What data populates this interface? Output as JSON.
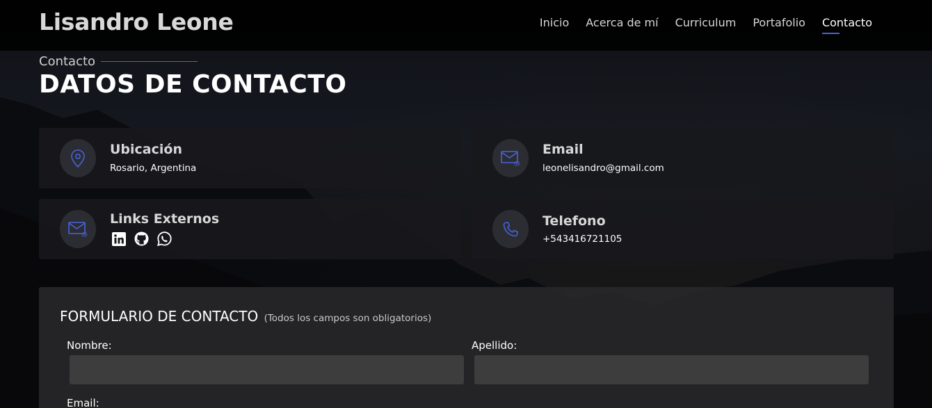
{
  "header": {
    "logo": "Lisandro Leone",
    "nav": [
      "Inicio",
      "Acerca de mí",
      "Curriculum",
      "Portafolio",
      "Contacto"
    ],
    "active": "Contacto"
  },
  "section": {
    "subtitle": "Contacto",
    "title": "DATOS DE CONTACTO"
  },
  "cards": {
    "location": {
      "title": "Ubicación",
      "text": "Rosario, Argentina",
      "icon": "map-pin-icon"
    },
    "email": {
      "title": "Email",
      "text": "leonelisandro@gmail.com",
      "icon": "envelope-icon"
    },
    "links": {
      "title": "Links Externos",
      "icon": "envelope-icon",
      "items": [
        "linkedin-icon",
        "github-icon",
        "whatsapp-icon"
      ]
    },
    "phone": {
      "title": "Telefono",
      "text": "+543416721105",
      "icon": "phone-icon"
    }
  },
  "form": {
    "title": "FORMULARIO DE CONTACTO",
    "note": "(Todos los campos son obligatorios)",
    "nombre_label": "Nombre:",
    "apellido_label": "Apellido:",
    "email_label": "Email:",
    "nombre_value": "",
    "apellido_value": ""
  },
  "colors": {
    "accent": "#4a62d8",
    "card_bg": "#18181c",
    "icon_bg": "#2b2d33"
  }
}
